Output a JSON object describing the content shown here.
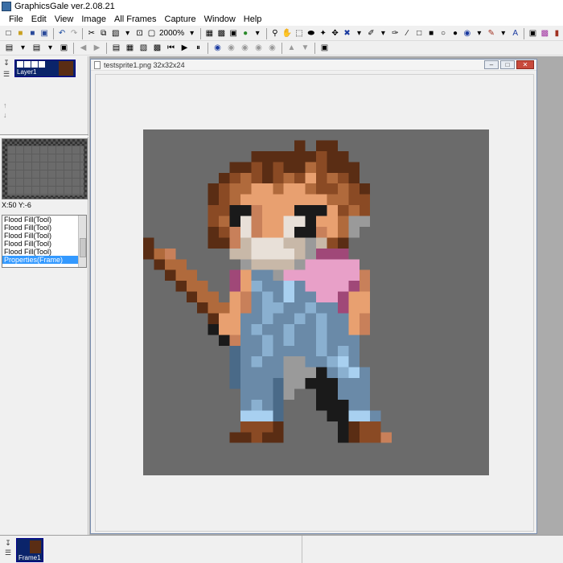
{
  "app": {
    "title": "GraphicsGale ver.2.08.21"
  },
  "menu": {
    "items": [
      "File",
      "Edit",
      "View",
      "Image",
      "All Frames",
      "Capture",
      "Window",
      "Help"
    ]
  },
  "toolbar": {
    "zoom_label": "2000%"
  },
  "layers": {
    "layer1_name": "Layer1"
  },
  "preview": {
    "coords": "X:50 Y:-6"
  },
  "history": {
    "rows": [
      "Flood Fill(Tool)",
      "Flood Fill(Tool)",
      "Flood Fill(Tool)",
      "Flood Fill(Tool)",
      "Flood Fill(Tool)",
      "Properties(Frame)"
    ],
    "selected_index": 5
  },
  "document": {
    "title": "testsprite1.png 32x32x24",
    "canvas_bg": "#6b6b6b"
  },
  "frames": {
    "frame1_name": "Frame1"
  },
  "colors": {
    "selection_blue": "#3399ff",
    "title_bar_dark": "#0a246a"
  }
}
